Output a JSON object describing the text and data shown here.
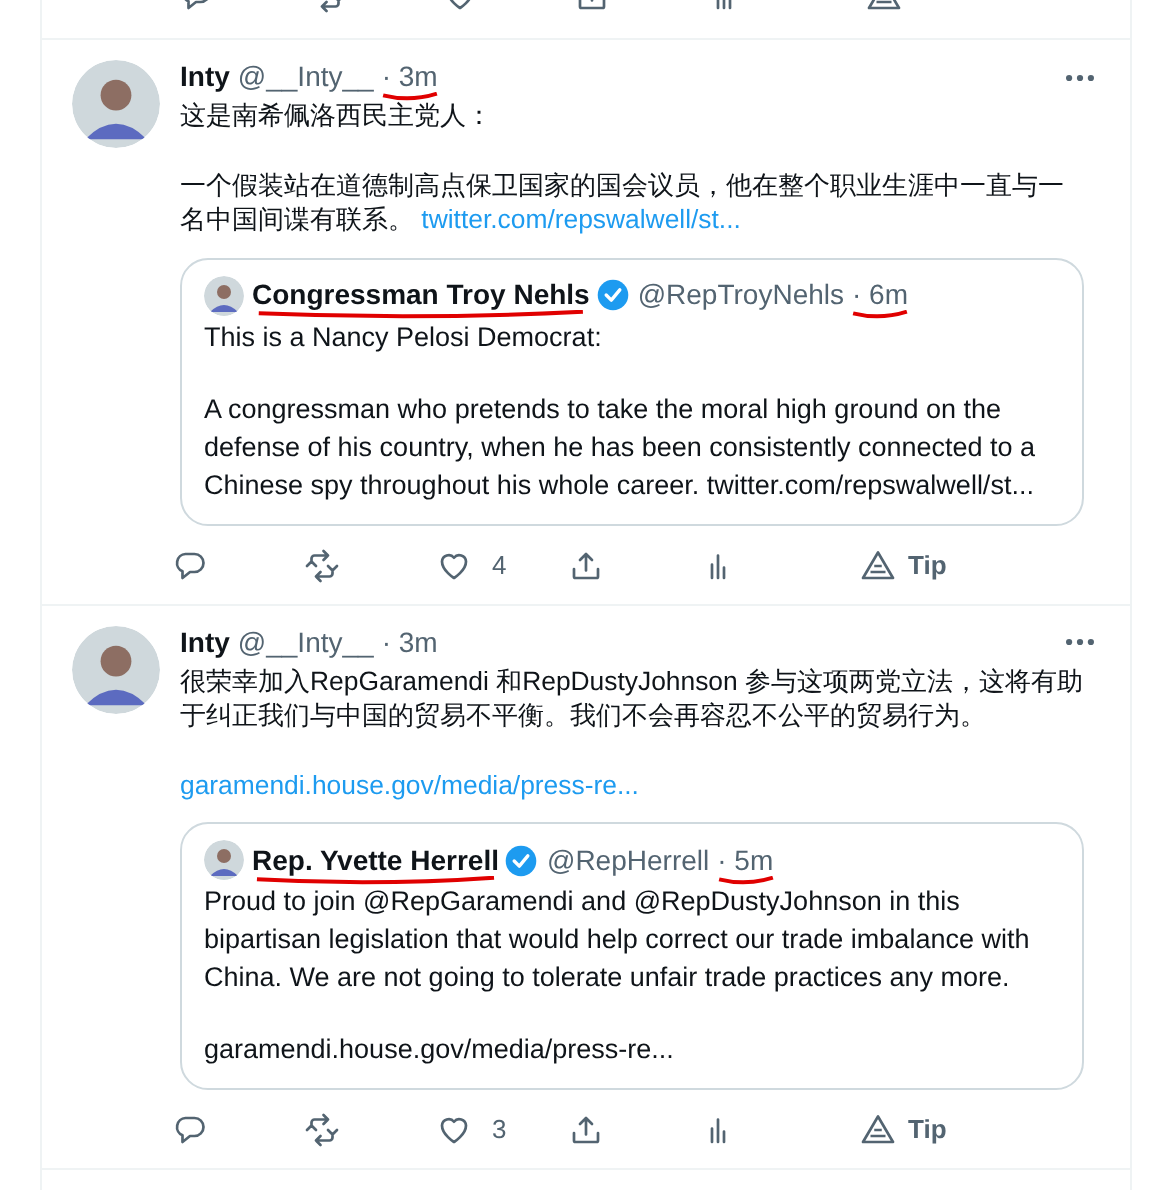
{
  "tweets": [
    {
      "author": {
        "name": "Inty",
        "handle": "@__Inty__",
        "time": "· 3m",
        "time_marked": true
      },
      "paragraphs": [
        {
          "text": "这是南希佩洛西民主党人："
        },
        {
          "text": "一个假装站在道德制高点保卫国家的国会议员，他在整个职业生涯中一直与一名中国间谍有联系。",
          "link": "twitter.com/repswalwell/st..."
        }
      ],
      "quote": {
        "name": "Congressman Troy Nehls",
        "name_marked": true,
        "verified": true,
        "handle": "@RepTroyNehls",
        "time": "· 6m",
        "time_marked": true,
        "paragraphs": [
          {
            "text": "This is a Nancy Pelosi Democrat:"
          },
          {
            "text": "A congressman who pretends to take the moral high ground on the defense of his country, when he has been consistently connected to a Chinese spy throughout his whole career. twitter.com/repswalwell/st..."
          }
        ]
      },
      "likes": "4",
      "tip": "Tip"
    },
    {
      "author": {
        "name": "Inty",
        "handle": "@__Inty__",
        "time": "· 3m",
        "time_marked": false
      },
      "paragraphs": [
        {
          "text": "很荣幸加入RepGaramendi 和RepDustyJohnson 参与这项两党立法，这将有助于纠正我们与中国的贸易不平衡。我们不会再容忍不公平的贸易行为。"
        },
        {
          "link": "garamendi.house.gov/media/press-re..."
        }
      ],
      "quote": {
        "name": "Rep. Yvette Herrell",
        "name_marked": true,
        "verified": true,
        "handle": "@RepHerrell",
        "time": "· 5m",
        "time_marked": true,
        "paragraphs": [
          {
            "text": "Proud to join @RepGaramendi and @RepDustyJohnson in this bipartisan legislation that would help correct our trade imbalance with China. We are not going to tolerate unfair trade practices any more."
          },
          {
            "text": "garamendi.house.gov/media/press-re..."
          }
        ]
      },
      "likes": "3",
      "tip": "Tip"
    }
  ]
}
